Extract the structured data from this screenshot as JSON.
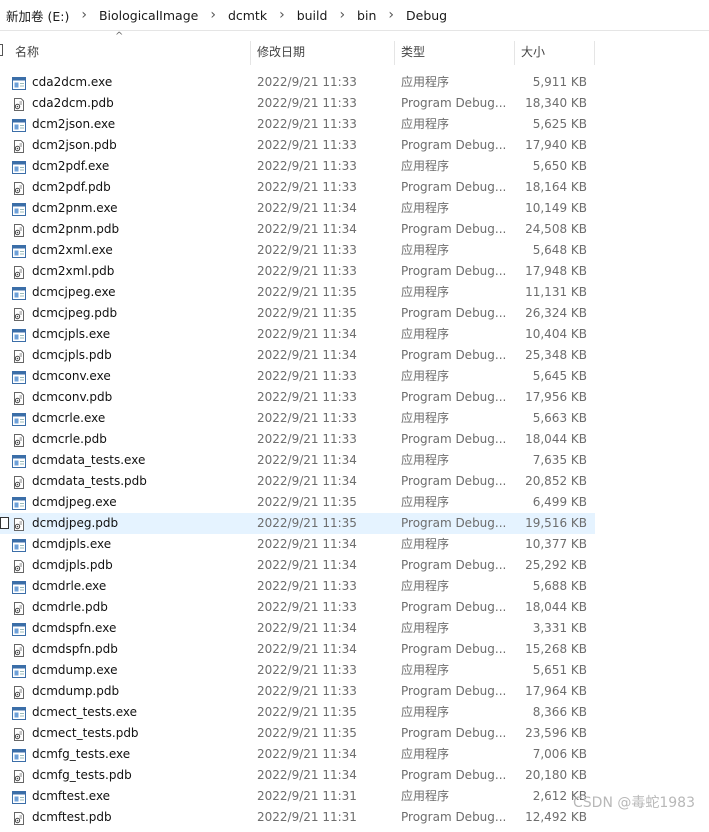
{
  "breadcrumb": [
    "新加卷 (E:)",
    "BiologicalImage",
    "dcmtk",
    "build",
    "bin",
    "Debug"
  ],
  "columns": {
    "name": "名称",
    "date": "修改日期",
    "type": "类型",
    "size": "大小"
  },
  "watermark": "CSDN @毒蛇1983",
  "selected_index": 21,
  "files": [
    {
      "name": "cda2dcm.exe",
      "date": "2022/9/21 11:33",
      "type": "应用程序",
      "size": "5,911 KB",
      "icon": "exe-icon"
    },
    {
      "name": "cda2dcm.pdb",
      "date": "2022/9/21 11:33",
      "type": "Program Debug...",
      "size": "18,340 KB",
      "icon": "pdb-icon"
    },
    {
      "name": "dcm2json.exe",
      "date": "2022/9/21 11:33",
      "type": "应用程序",
      "size": "5,625 KB",
      "icon": "exe-icon"
    },
    {
      "name": "dcm2json.pdb",
      "date": "2022/9/21 11:33",
      "type": "Program Debug...",
      "size": "17,940 KB",
      "icon": "pdb-icon"
    },
    {
      "name": "dcm2pdf.exe",
      "date": "2022/9/21 11:33",
      "type": "应用程序",
      "size": "5,650 KB",
      "icon": "exe-icon"
    },
    {
      "name": "dcm2pdf.pdb",
      "date": "2022/9/21 11:33",
      "type": "Program Debug...",
      "size": "18,164 KB",
      "icon": "pdb-icon"
    },
    {
      "name": "dcm2pnm.exe",
      "date": "2022/9/21 11:34",
      "type": "应用程序",
      "size": "10,149 KB",
      "icon": "exe-icon"
    },
    {
      "name": "dcm2pnm.pdb",
      "date": "2022/9/21 11:34",
      "type": "Program Debug...",
      "size": "24,508 KB",
      "icon": "pdb-icon"
    },
    {
      "name": "dcm2xml.exe",
      "date": "2022/9/21 11:33",
      "type": "应用程序",
      "size": "5,648 KB",
      "icon": "exe-icon"
    },
    {
      "name": "dcm2xml.pdb",
      "date": "2022/9/21 11:33",
      "type": "Program Debug...",
      "size": "17,948 KB",
      "icon": "pdb-icon"
    },
    {
      "name": "dcmcjpeg.exe",
      "date": "2022/9/21 11:35",
      "type": "应用程序",
      "size": "11,131 KB",
      "icon": "exe-icon"
    },
    {
      "name": "dcmcjpeg.pdb",
      "date": "2022/9/21 11:35",
      "type": "Program Debug...",
      "size": "26,324 KB",
      "icon": "pdb-icon"
    },
    {
      "name": "dcmcjpls.exe",
      "date": "2022/9/21 11:34",
      "type": "应用程序",
      "size": "10,404 KB",
      "icon": "exe-icon"
    },
    {
      "name": "dcmcjpls.pdb",
      "date": "2022/9/21 11:34",
      "type": "Program Debug...",
      "size": "25,348 KB",
      "icon": "pdb-icon"
    },
    {
      "name": "dcmconv.exe",
      "date": "2022/9/21 11:33",
      "type": "应用程序",
      "size": "5,645 KB",
      "icon": "exe-icon"
    },
    {
      "name": "dcmconv.pdb",
      "date": "2022/9/21 11:33",
      "type": "Program Debug...",
      "size": "17,956 KB",
      "icon": "pdb-icon"
    },
    {
      "name": "dcmcrle.exe",
      "date": "2022/9/21 11:33",
      "type": "应用程序",
      "size": "5,663 KB",
      "icon": "exe-icon"
    },
    {
      "name": "dcmcrle.pdb",
      "date": "2022/9/21 11:33",
      "type": "Program Debug...",
      "size": "18,044 KB",
      "icon": "pdb-icon"
    },
    {
      "name": "dcmdata_tests.exe",
      "date": "2022/9/21 11:34",
      "type": "应用程序",
      "size": "7,635 KB",
      "icon": "exe-icon"
    },
    {
      "name": "dcmdata_tests.pdb",
      "date": "2022/9/21 11:34",
      "type": "Program Debug...",
      "size": "20,852 KB",
      "icon": "pdb-icon"
    },
    {
      "name": "dcmdjpeg.exe",
      "date": "2022/9/21 11:35",
      "type": "应用程序",
      "size": "6,499 KB",
      "icon": "exe-icon"
    },
    {
      "name": "dcmdjpeg.pdb",
      "date": "2022/9/21 11:35",
      "type": "Program Debug...",
      "size": "19,516 KB",
      "icon": "pdb-icon"
    },
    {
      "name": "dcmdjpls.exe",
      "date": "2022/9/21 11:34",
      "type": "应用程序",
      "size": "10,377 KB",
      "icon": "exe-icon"
    },
    {
      "name": "dcmdjpls.pdb",
      "date": "2022/9/21 11:34",
      "type": "Program Debug...",
      "size": "25,292 KB",
      "icon": "pdb-icon"
    },
    {
      "name": "dcmdrle.exe",
      "date": "2022/9/21 11:33",
      "type": "应用程序",
      "size": "5,688 KB",
      "icon": "exe-icon"
    },
    {
      "name": "dcmdrle.pdb",
      "date": "2022/9/21 11:33",
      "type": "Program Debug...",
      "size": "18,044 KB",
      "icon": "pdb-icon"
    },
    {
      "name": "dcmdspfn.exe",
      "date": "2022/9/21 11:34",
      "type": "应用程序",
      "size": "3,331 KB",
      "icon": "exe-icon"
    },
    {
      "name": "dcmdspfn.pdb",
      "date": "2022/9/21 11:34",
      "type": "Program Debug...",
      "size": "15,268 KB",
      "icon": "pdb-icon"
    },
    {
      "name": "dcmdump.exe",
      "date": "2022/9/21 11:33",
      "type": "应用程序",
      "size": "5,651 KB",
      "icon": "exe-icon"
    },
    {
      "name": "dcmdump.pdb",
      "date": "2022/9/21 11:33",
      "type": "Program Debug...",
      "size": "17,964 KB",
      "icon": "pdb-icon"
    },
    {
      "name": "dcmect_tests.exe",
      "date": "2022/9/21 11:35",
      "type": "应用程序",
      "size": "8,366 KB",
      "icon": "exe-icon"
    },
    {
      "name": "dcmect_tests.pdb",
      "date": "2022/9/21 11:35",
      "type": "Program Debug...",
      "size": "23,596 KB",
      "icon": "pdb-icon"
    },
    {
      "name": "dcmfg_tests.exe",
      "date": "2022/9/21 11:34",
      "type": "应用程序",
      "size": "7,006 KB",
      "icon": "exe-icon"
    },
    {
      "name": "dcmfg_tests.pdb",
      "date": "2022/9/21 11:34",
      "type": "Program Debug...",
      "size": "20,180 KB",
      "icon": "pdb-icon"
    },
    {
      "name": "dcmftest.exe",
      "date": "2022/9/21 11:31",
      "type": "应用程序",
      "size": "2,612 KB",
      "icon": "exe-icon"
    },
    {
      "name": "dcmftest.pdb",
      "date": "2022/9/21 11:31",
      "type": "Program Debug...",
      "size": "12,492 KB",
      "icon": "pdb-icon"
    }
  ]
}
